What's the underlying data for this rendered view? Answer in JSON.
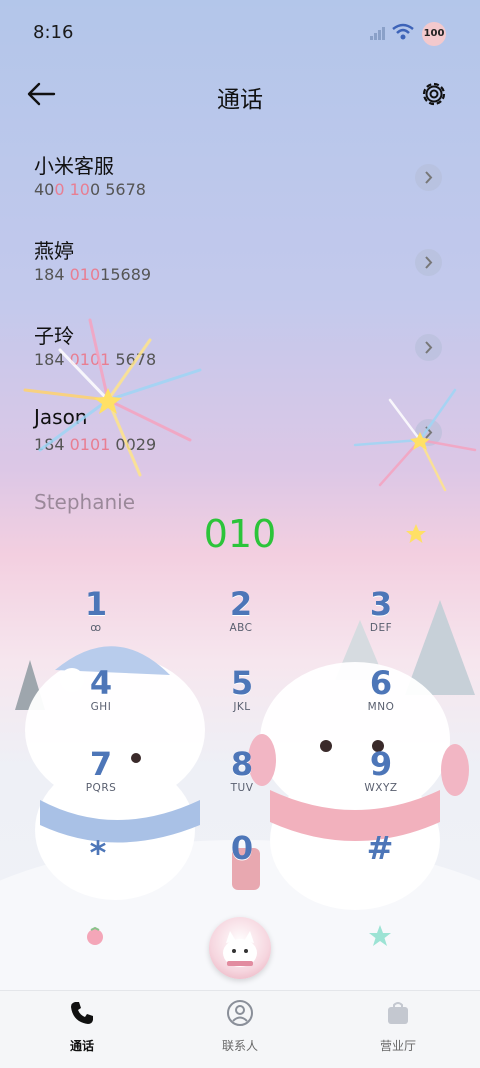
{
  "status": {
    "time": "8:16",
    "battery": "100"
  },
  "header": {
    "title": "通话"
  },
  "contacts": [
    {
      "name": "小米客服",
      "num_pre": "40",
      "num_hl": "0 10",
      "num_post": "0 5678"
    },
    {
      "name": "燕婷",
      "num_pre": "184 ",
      "num_hl": "010",
      "num_post": "15689"
    },
    {
      "name": "子玲",
      "num_pre": "184 ",
      "num_hl": "0101",
      "num_post": " 5678"
    },
    {
      "name": "Jason",
      "num_pre": "184 ",
      "num_hl": "0101",
      "num_post": " 0029"
    },
    {
      "name": "Stephanie"
    }
  ],
  "dialed": "010",
  "keypad": [
    {
      "digit": "1",
      "letters": "ꝏ"
    },
    {
      "digit": "2",
      "letters": "ABC"
    },
    {
      "digit": "3",
      "letters": "DEF"
    },
    {
      "digit": "4",
      "letters": "GHI"
    },
    {
      "digit": "5",
      "letters": "JKL"
    },
    {
      "digit": "6",
      "letters": "MNO"
    },
    {
      "digit": "7",
      "letters": "PQRS"
    },
    {
      "digit": "8",
      "letters": "TUV"
    },
    {
      "digit": "9",
      "letters": "WXYZ"
    },
    {
      "digit": "*",
      "letters": ""
    },
    {
      "digit": "0",
      "letters": ""
    },
    {
      "digit": "#",
      "letters": ""
    }
  ],
  "tabs": [
    {
      "label": "通话",
      "icon": "phone-icon",
      "active": true
    },
    {
      "label": "联系人",
      "icon": "person-icon",
      "active": false
    },
    {
      "label": "营业厅",
      "icon": "bag-icon",
      "active": false
    }
  ],
  "colors": {
    "accent_green": "#2cc43a",
    "highlight_pink": "#e87e92",
    "key_blue": "#4d76b8"
  }
}
